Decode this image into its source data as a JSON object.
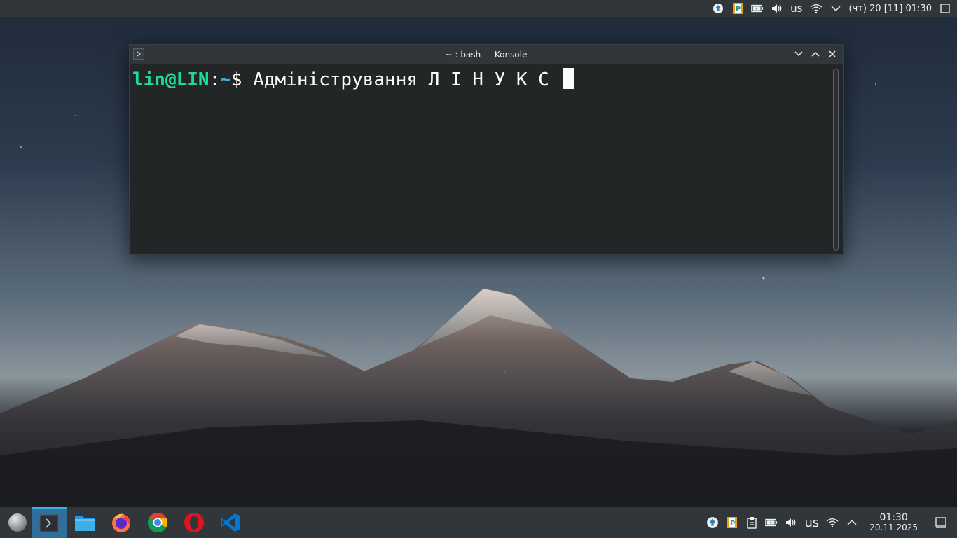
{
  "top_panel": {
    "keyboard_layout": "us",
    "datetime": "(чт) 20 [11] 01:30",
    "icons": [
      "update-icon",
      "pamac-icon",
      "battery-icon",
      "volume-icon",
      "keyboard-layout",
      "wifi-icon",
      "expand-chevron-icon",
      "show-desktop-icon"
    ]
  },
  "window": {
    "title": "~ : bash — Konsole",
    "terminal": {
      "user_host": "lin@LIN",
      "separator": ":",
      "path": "~",
      "prompt_symbol": "$",
      "input": " Адміністрування Л І Н У К С "
    },
    "buttons": [
      "minimize",
      "maximize",
      "close"
    ]
  },
  "taskbar": {
    "apps": [
      {
        "name": "launcher",
        "icon": "menu-launcher-icon"
      },
      {
        "name": "konsole",
        "icon": "konsole-icon",
        "active": true
      },
      {
        "name": "dolphin",
        "icon": "folder-icon"
      },
      {
        "name": "firefox",
        "icon": "firefox-icon"
      },
      {
        "name": "chrome",
        "icon": "chrome-icon"
      },
      {
        "name": "opera",
        "icon": "opera-icon"
      },
      {
        "name": "vscode",
        "icon": "vscode-icon"
      }
    ],
    "tray": {
      "keyboard_layout": "us",
      "clock_time": "01:30",
      "clock_date": "20.11.2025"
    }
  },
  "colors": {
    "panel": "#31363b",
    "terminal_bg": "#232627",
    "prompt_user": "#1cdc9a",
    "prompt_path": "#3daee9",
    "active_task": "#2f6f9a"
  }
}
